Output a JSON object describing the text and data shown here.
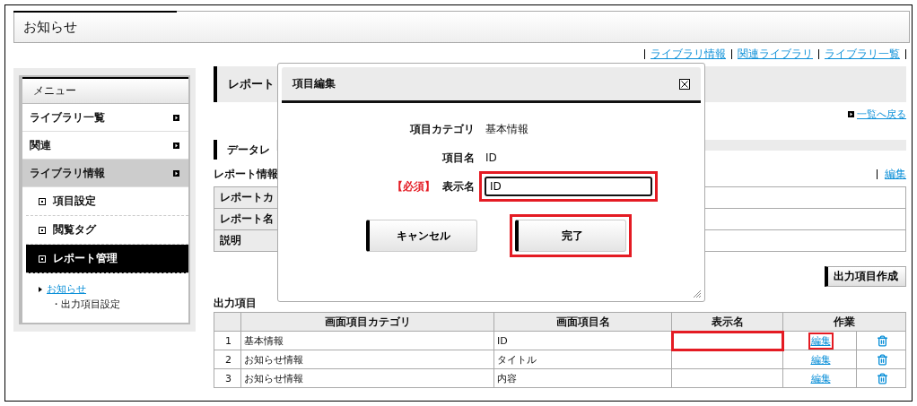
{
  "header": {
    "title": "お知らせ"
  },
  "top_links": [
    "ライブラリ情報",
    "関連ライブラリ",
    "ライブラリ一覧"
  ],
  "sidebar": {
    "title": "メニュー",
    "items": [
      {
        "label": "ライブラリ一覧",
        "selected": false
      },
      {
        "label": "関連",
        "selected": false
      },
      {
        "label": "ライブラリ情報",
        "selected": true,
        "children": [
          {
            "label": "項目設定",
            "selected": false
          },
          {
            "label": "閲覧タグ",
            "selected": false
          },
          {
            "label": "レポート管理",
            "selected": true
          }
        ]
      }
    ],
    "breadcrumb": {
      "link": "お知らせ",
      "current": "・出力項目設定"
    }
  },
  "page_title": "レポート",
  "back_link": "一覧へ戻る",
  "section_title": "データレ",
  "report_info": {
    "label": "レポート情報",
    "edit_link": "編集",
    "rows": [
      "レポートカ",
      "レポート名",
      "説明"
    ]
  },
  "create_button": "出力項目作成",
  "output": {
    "label": "出力項目",
    "columns": [
      "画面項目カテゴリ",
      "画面項目名",
      "表示名",
      "作業"
    ],
    "rows": [
      {
        "no": "1",
        "category": "基本情報",
        "name": "ID",
        "edit": "編集",
        "highlighted": true
      },
      {
        "no": "2",
        "category": "お知らせ情報",
        "name": "タイトル",
        "edit": "編集",
        "highlighted": false
      },
      {
        "no": "3",
        "category": "お知らせ情報",
        "name": "内容",
        "edit": "編集",
        "highlighted": false
      }
    ]
  },
  "dialog": {
    "title": "項目編集",
    "fields": [
      {
        "kind": "text",
        "label": "項目カテゴリ",
        "value": "基本情報"
      },
      {
        "kind": "text",
        "label": "項目名",
        "value": "ID"
      },
      {
        "kind": "input",
        "required_mark": "【必須】",
        "label": "表示名",
        "value": "ID",
        "highlighted": true
      }
    ],
    "buttons": [
      {
        "label": "キャンセル",
        "highlighted": false
      },
      {
        "label": "完了",
        "highlighted": true
      }
    ]
  }
}
